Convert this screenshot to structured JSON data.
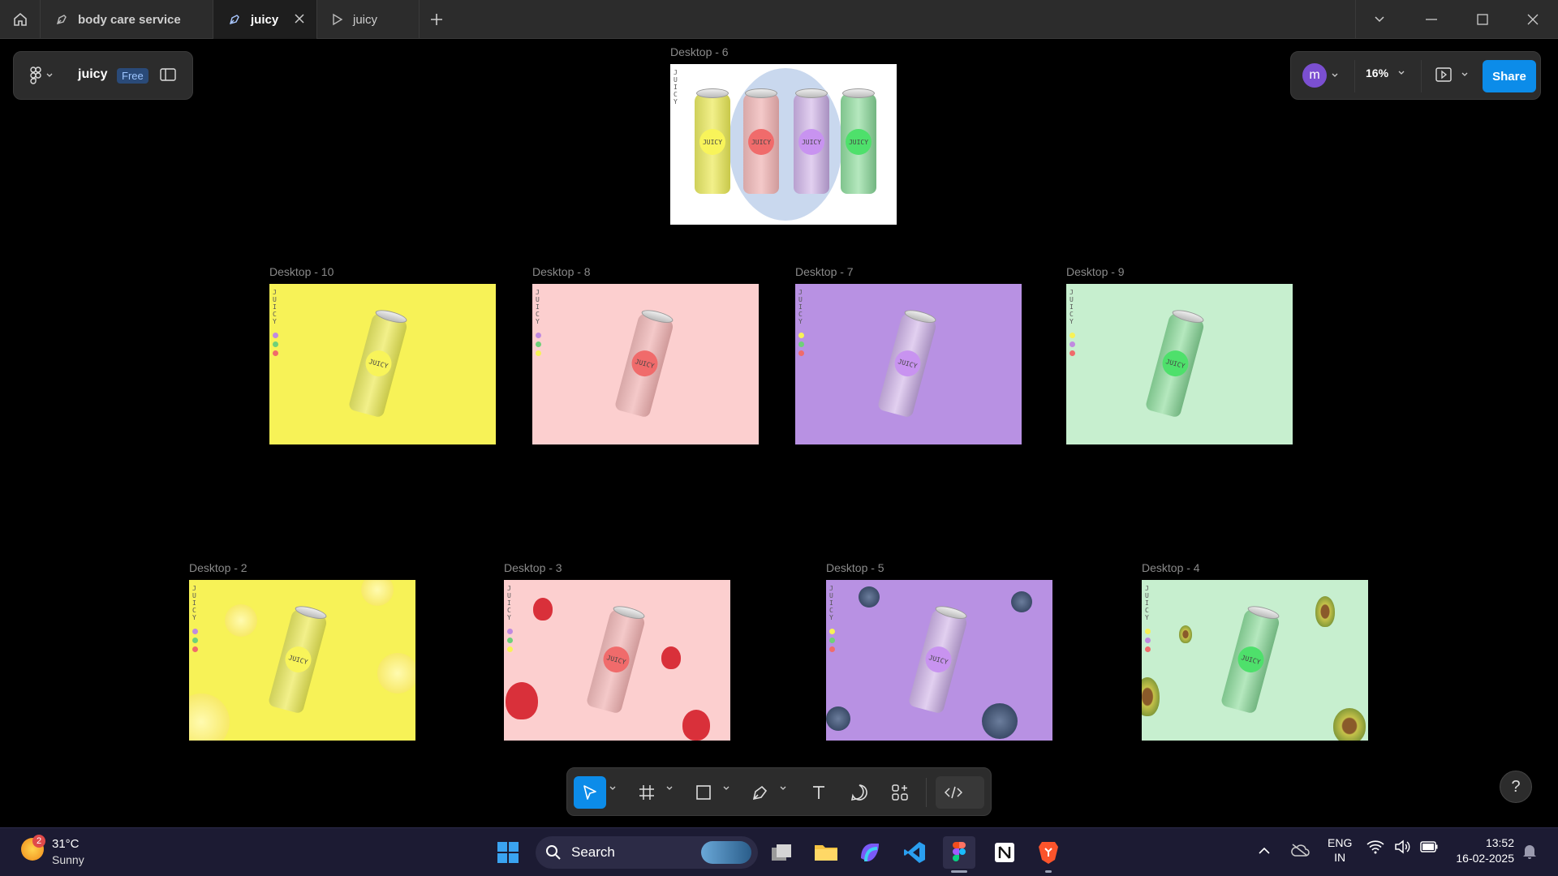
{
  "tabs": [
    {
      "label": "body care service",
      "icon": "pen-nib-icon"
    },
    {
      "label": "juicy",
      "icon": "pen-nib-icon",
      "active": true
    },
    {
      "label": "juicy",
      "icon": "play-icon"
    }
  ],
  "file": {
    "name": "juicy",
    "plan": "Free"
  },
  "right_panel": {
    "avatar": "m",
    "zoom": "16%",
    "share": "Share"
  },
  "frames": {
    "d6": "Desktop - 6",
    "d10": "Desktop - 10",
    "d8": "Desktop - 8",
    "d7": "Desktop - 7",
    "d9": "Desktop - 9",
    "d2": "Desktop - 2",
    "d3": "Desktop - 3",
    "d5": "Desktop - 5",
    "d4": "Desktop - 4"
  },
  "artwork": {
    "can_text": "JUICY",
    "side_text": "JUICY"
  },
  "colors": {
    "yellow": "#f7f257",
    "pink": "#fccfcf",
    "purple": "#b891e3",
    "green": "#c7efcf",
    "accent": "#0c8ce9",
    "avatar": "#7b4fd1"
  },
  "help": "?",
  "taskbar": {
    "weather_badge": "2",
    "temp": "31°C",
    "condition": "Sunny",
    "search": "Search",
    "lang1": "ENG",
    "lang2": "IN",
    "time": "13:52",
    "date": "16-02-2025"
  }
}
